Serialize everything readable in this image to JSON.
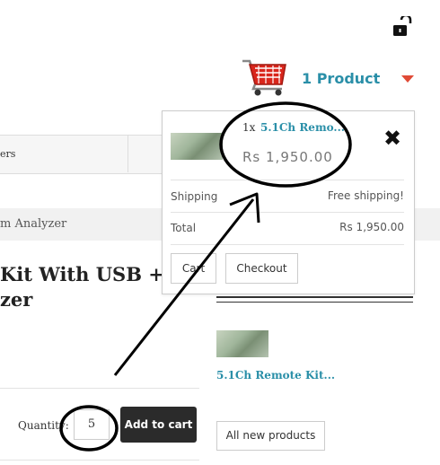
{
  "header": {
    "lock_icon": "unlocked-padlock-icon",
    "cart_icon": "shopping-cart-icon",
    "cart_count_label": "1 Product",
    "caret_icon": "caret-down-icon",
    "accent_color": "#2a8fa8",
    "caret_color": "#e04a36"
  },
  "background": {
    "nav_partial_text": "ers",
    "breadcrumb_partial_text": "m Analyzer",
    "title_line1": "Kit With USB +",
    "title_line2": "zer",
    "quantity_label": "Quantity:",
    "quantity_value": "5",
    "add_to_cart_label": "Add to cart"
  },
  "sidebar": {
    "product_name": "5.1Ch Remote Kit...",
    "all_new_label": "All new products"
  },
  "cart_dropdown": {
    "item_quantity": "1x",
    "item_name": "5.1Ch Remo...",
    "item_price": "Rs 1,950.00",
    "remove_icon": "close-x-icon",
    "shipping_label": "Shipping",
    "shipping_value": "Free shipping!",
    "total_label": "Total",
    "total_value": "Rs 1,950.00",
    "cart_button": "Cart",
    "checkout_button": "Checkout"
  }
}
